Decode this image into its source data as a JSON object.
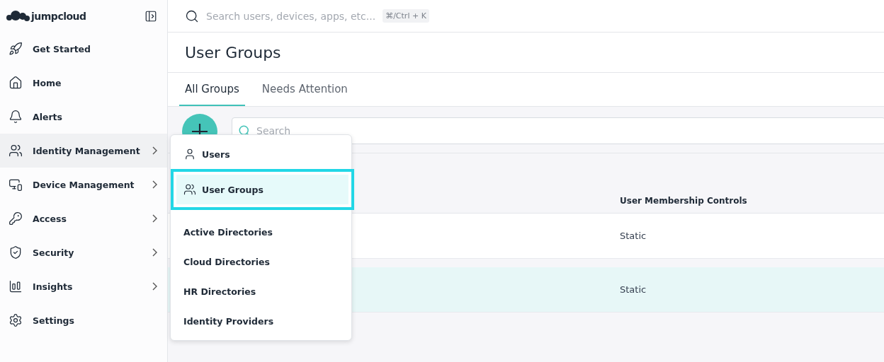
{
  "logo": {
    "text": "jumpcloud"
  },
  "search": {
    "placeholder": "Search users, devices, apps, etc...",
    "shortcut": "⌘/Ctrl + K"
  },
  "sidebar": {
    "items": [
      {
        "label": "Get Started",
        "expandable": false,
        "selected": false
      },
      {
        "label": "Home",
        "expandable": false,
        "selected": false
      },
      {
        "label": "Alerts",
        "expandable": false,
        "selected": false
      },
      {
        "label": "Identity Management",
        "expandable": true,
        "selected": true
      },
      {
        "label": "Device Management",
        "expandable": true,
        "selected": false
      },
      {
        "label": "Access",
        "expandable": true,
        "selected": false
      },
      {
        "label": "Security",
        "expandable": true,
        "selected": false
      },
      {
        "label": "Insights",
        "expandable": true,
        "selected": false
      },
      {
        "label": "Settings",
        "expandable": false,
        "selected": false
      }
    ]
  },
  "page_title": "User Groups",
  "tabs": [
    {
      "label": "All Groups",
      "selected": true
    },
    {
      "label": "Needs Attention",
      "selected": false
    }
  ],
  "toolbar": {
    "search_placeholder": "Search"
  },
  "table": {
    "columns": [
      "User Membership Controls"
    ],
    "rows": [
      {
        "cells": [
          "Static"
        ],
        "selected": false
      },
      {
        "cells": [
          "Static"
        ],
        "selected": true
      }
    ]
  },
  "menu": {
    "items": [
      {
        "label": "Users",
        "kind": "icon",
        "selected": false
      },
      {
        "label": "User Groups",
        "kind": "icon",
        "selected": true
      },
      {
        "label": "Active Directories",
        "kind": "plain",
        "selected": false
      },
      {
        "label": "Cloud Directories",
        "kind": "plain",
        "selected": false
      },
      {
        "label": "HR Directories",
        "kind": "plain",
        "selected": false
      },
      {
        "label": "Identity Providers",
        "kind": "plain",
        "selected": false
      }
    ]
  }
}
